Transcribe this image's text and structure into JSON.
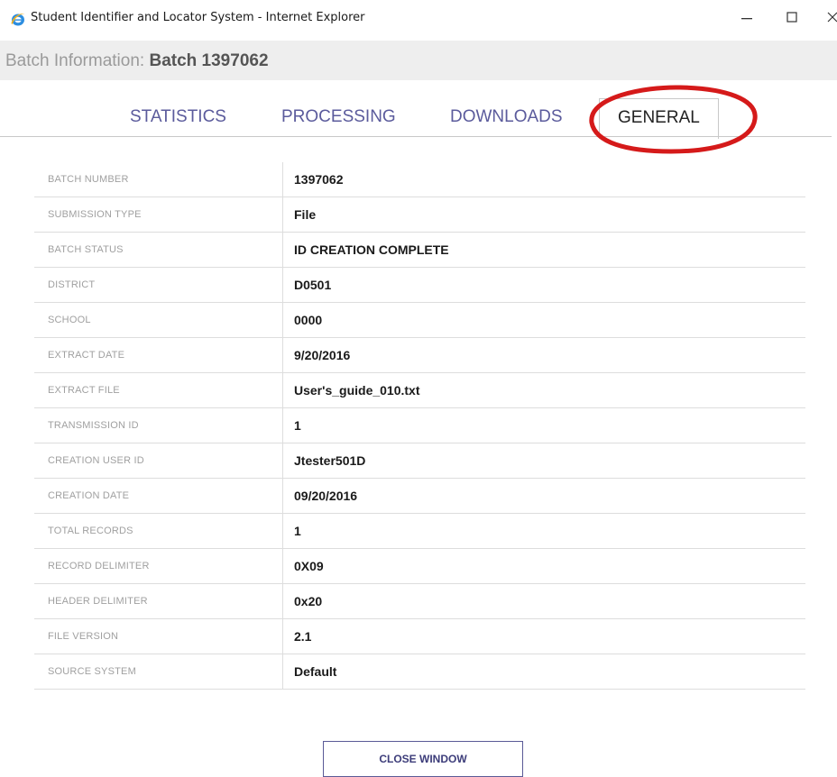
{
  "window": {
    "title": "Student Identifier and Locator System - Internet Explorer",
    "browser_icon": "internet-explorer-icon",
    "controls": [
      "minimize-icon",
      "maximize-icon",
      "close-icon"
    ]
  },
  "header": {
    "label": "Batch Information:",
    "batch_name": "Batch 1397062"
  },
  "tabs": [
    {
      "label": "STATISTICS",
      "active": false
    },
    {
      "label": "PROCESSING",
      "active": false
    },
    {
      "label": "DOWNLOADS",
      "active": false
    },
    {
      "label": "GENERAL",
      "active": true
    }
  ],
  "annotation": {
    "highlight_color": "#d51a1a",
    "highlighted_tab": "GENERAL"
  },
  "general": {
    "rows": [
      {
        "label": "BATCH NUMBER",
        "value": "1397062"
      },
      {
        "label": "SUBMISSION TYPE",
        "value": "File"
      },
      {
        "label": "BATCH STATUS",
        "value": "ID CREATION COMPLETE"
      },
      {
        "label": "DISTRICT",
        "value": "D0501"
      },
      {
        "label": "SCHOOL",
        "value": "0000"
      },
      {
        "label": "EXTRACT DATE",
        "value": "9/20/2016"
      },
      {
        "label": "EXTRACT FILE",
        "value": "User's_guide_010.txt"
      },
      {
        "label": "TRANSMISSION ID",
        "value": "1"
      },
      {
        "label": "CREATION USER ID",
        "value": "Jtester501D"
      },
      {
        "label": "CREATION DATE",
        "value": "09/20/2016"
      },
      {
        "label": "TOTAL RECORDS",
        "value": "1"
      },
      {
        "label": "RECORD DELIMITER",
        "value": "0X09"
      },
      {
        "label": "HEADER DELIMITER",
        "value": "0x20"
      },
      {
        "label": "FILE VERSION",
        "value": "2.1"
      },
      {
        "label": "SOURCE SYSTEM",
        "value": "Default"
      }
    ]
  },
  "footer": {
    "close_label": "CLOSE WINDOW"
  },
  "colors": {
    "tab_text": "#5b5b9c",
    "header_bar": "#eeeeee",
    "button_border": "#5a5a96"
  }
}
